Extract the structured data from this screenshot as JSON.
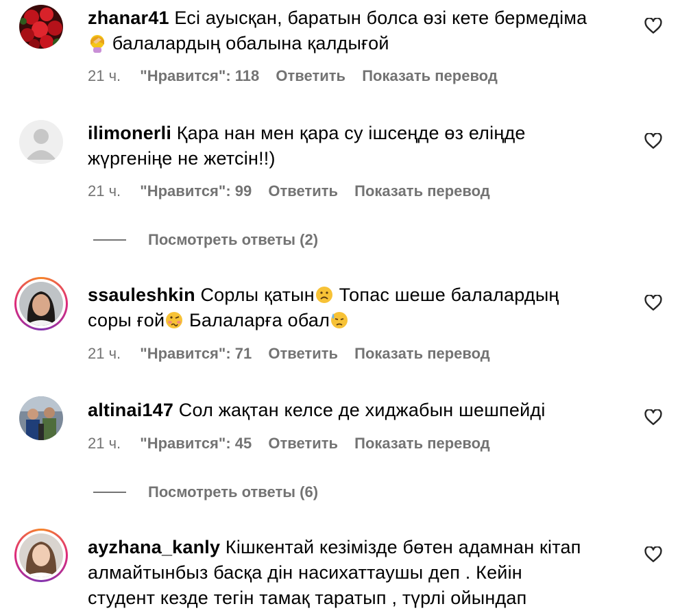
{
  "comments": [
    {
      "username": "zhanar41",
      "text1": "Есі ауысқан, баратын болса өзі кете бермедіма",
      "text2": "балалардың обалына қалдығой",
      "time": "21 ч.",
      "likes": "\"Нравится\": 118",
      "reply": "Ответить",
      "translate": "Показать перевод"
    },
    {
      "username": "ilimonerli",
      "text1": "Қара нан мен қара су ішсеңде өз еліңде",
      "text2": "жүргеніңе не жетсін!!)",
      "time": "21 ч.",
      "likes": "\"Нравится\": 99",
      "reply": "Ответить",
      "translate": "Показать перевод",
      "view_replies": "Посмотреть ответы (2)"
    },
    {
      "username": "ssauleshkin",
      "text1a": "Сорлы қатын",
      "text1b": " Топас шеше балалардың",
      "text2a": "соры ғой",
      "text2b": " Балаларға обал",
      "time": "21 ч.",
      "likes": "\"Нравится\": 71",
      "reply": "Ответить",
      "translate": "Показать перевод"
    },
    {
      "username": "altinai147",
      "text1": "Сол жақтан келсе де хиджабын шешпейді",
      "time": "21 ч.",
      "likes": "\"Нравится\": 45",
      "reply": "Ответить",
      "translate": "Показать перевод",
      "view_replies": "Посмотреть ответы (6)"
    },
    {
      "username": "ayzhana_kanly",
      "text1": "Кішкентай кезімізде бөтен адамнан кітап",
      "text2": "алмайтынбыз басқа дін насихаттаушы деп . Кейін",
      "text3": "студент кезде тегін тамақ таратып , түрлі ойындап"
    }
  ],
  "colors": {
    "secondary": "#737373",
    "story_ring": [
      "#f58529",
      "#dd2a7b",
      "#8134af"
    ]
  },
  "icons": [
    "heart-outline-icon",
    "emoji-woman-facepalming",
    "emoji-frowning",
    "emoji-woozy",
    "emoji-downcast-sweat"
  ]
}
